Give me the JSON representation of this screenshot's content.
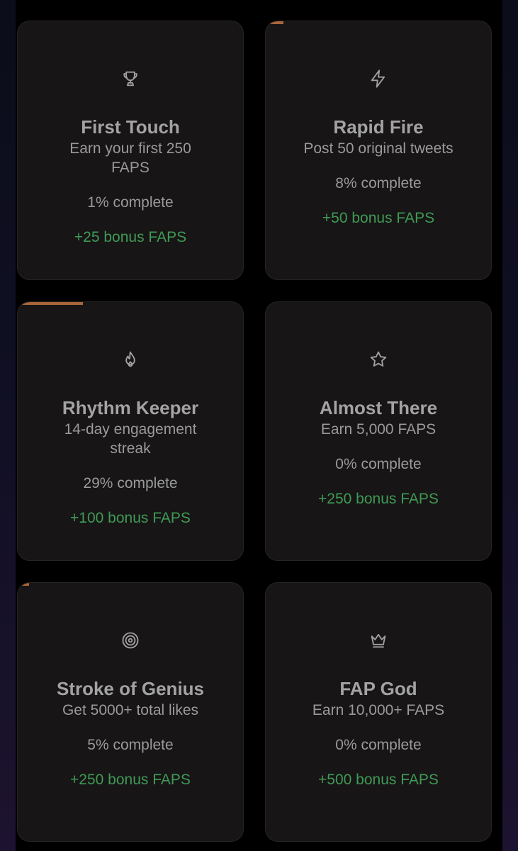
{
  "colors": {
    "card_bg": "#171515",
    "progress": "#a8663a",
    "bonus_text": "#3f9a56",
    "title_text": "#a3a3a3"
  },
  "achievements": [
    {
      "icon": "trophy-icon",
      "title": "First Touch",
      "description": "Earn your first 250 FAPS",
      "progress_text": "1% complete",
      "progress": 1,
      "bonus": "+25 bonus FAPS"
    },
    {
      "icon": "lightning-icon",
      "title": "Rapid Fire",
      "description": "Post 50 original tweets",
      "progress_text": "8% complete",
      "progress": 8,
      "bonus": "+50 bonus FAPS"
    },
    {
      "icon": "flame-icon",
      "title": "Rhythm Keeper",
      "description": "14-day engagement streak",
      "progress_text": "29% complete",
      "progress": 29,
      "bonus": "+100 bonus FAPS"
    },
    {
      "icon": "star-icon",
      "title": "Almost There",
      "description": "Earn 5,000 FAPS",
      "progress_text": "0% complete",
      "progress": 0,
      "bonus": "+250 bonus FAPS"
    },
    {
      "icon": "target-icon",
      "title": "Stroke of Genius",
      "description": "Get 5000+ total likes",
      "progress_text": "5% complete",
      "progress": 5,
      "bonus": "+250 bonus FAPS"
    },
    {
      "icon": "crown-icon",
      "title": "FAP God",
      "description": "Earn 10,000+ FAPS",
      "progress_text": "0% complete",
      "progress": 0,
      "bonus": "+500 bonus FAPS"
    }
  ]
}
